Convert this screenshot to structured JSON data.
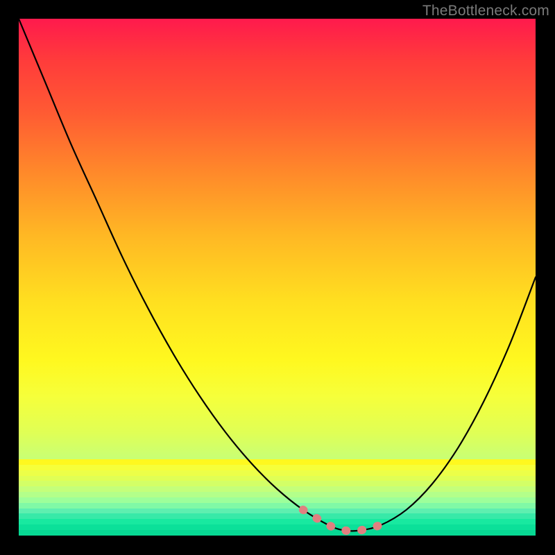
{
  "watermark": "TheBottleneck.com",
  "chart_data": {
    "type": "line",
    "title": "",
    "xlabel": "",
    "ylabel": "",
    "x": [
      0.0,
      0.05,
      0.1,
      0.15,
      0.2,
      0.25,
      0.3,
      0.35,
      0.4,
      0.45,
      0.5,
      0.55,
      0.6,
      0.63,
      0.66,
      0.7,
      0.75,
      0.8,
      0.85,
      0.9,
      0.95,
      1.0
    ],
    "y": [
      1.0,
      0.88,
      0.76,
      0.65,
      0.54,
      0.44,
      0.35,
      0.27,
      0.2,
      0.14,
      0.09,
      0.05,
      0.02,
      0.01,
      0.01,
      0.02,
      0.05,
      0.1,
      0.17,
      0.26,
      0.37,
      0.5
    ],
    "xlim": [
      0,
      1
    ],
    "ylim": [
      0,
      1
    ],
    "highlight_region": {
      "x_start": 0.53,
      "x_end": 0.7,
      "color": "#e08080"
    },
    "bottom_band_colors": [
      "#fff81f",
      "#f6ff3a",
      "#ecff48",
      "#e0ff55",
      "#d3ff66",
      "#c4ff7a",
      "#b3ff8a",
      "#9dff9a",
      "#80f9a6",
      "#5eefb0",
      "#38e9a8",
      "#18e9a0",
      "#0be099",
      "#07d893"
    ]
  }
}
